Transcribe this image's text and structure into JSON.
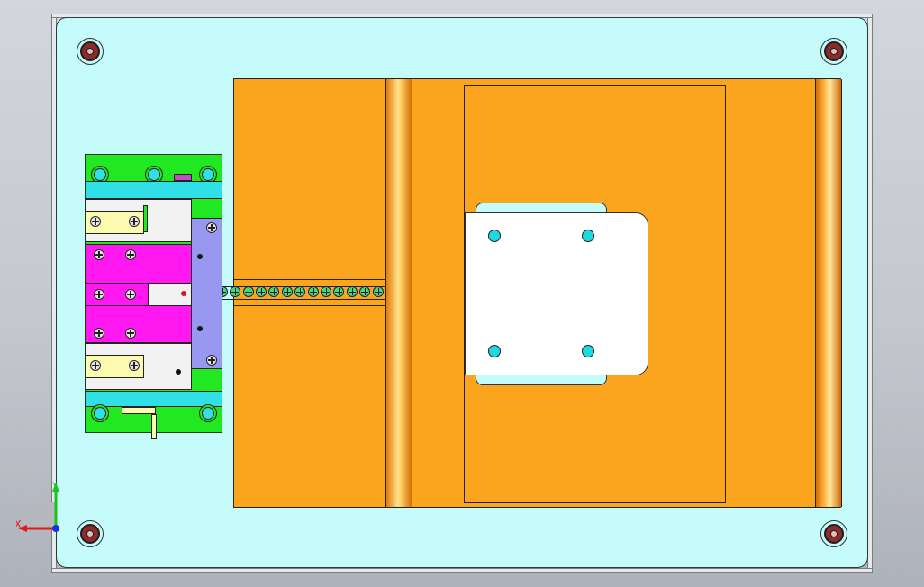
{
  "viewport": {
    "background": "#c9ccd2",
    "triad": {
      "x_label": "X",
      "y_label": "Y",
      "x_color": "#e01818",
      "y_color": "#18c418",
      "z_color": "#1830e0"
    }
  },
  "base_plate": {
    "color": "#c5fbfb",
    "mounting_holes": 4
  },
  "slide_plate": {
    "color": "#fba51f",
    "rails": 2,
    "carrier_plate": {
      "color": "#ffffff",
      "bolt_color": "#1fd8e2",
      "bolts": 4
    }
  },
  "feed_chain": {
    "beads": 15,
    "color": "#4fd47a"
  },
  "mold_block": {
    "base_color": "#22e822",
    "clamp_color": "#ff19f0",
    "guide_color": "#9898f0",
    "pad_color": "#fdfbb0",
    "cap_color": "#30e0e6"
  }
}
